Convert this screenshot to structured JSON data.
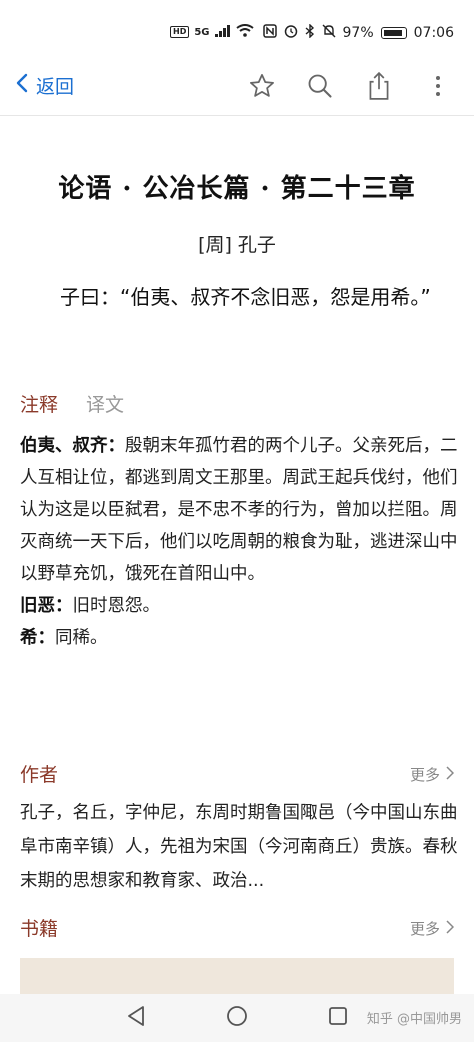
{
  "status_bar": {
    "hd": "HD",
    "network": "5G",
    "battery": "97%",
    "time": "07:06"
  },
  "nav": {
    "back_label": "返回",
    "icons": [
      "back-chevron-icon",
      "star-icon",
      "search-icon",
      "share-icon",
      "more-vertical-icon"
    ]
  },
  "article": {
    "title": "论语 · 公冶长篇 · 第二十三章",
    "author": "[周] 孔子",
    "text": "子曰：“伯夷、叔齐不念旧恶，怨是用希。”"
  },
  "tabs": [
    {
      "label": "注释",
      "active": true
    },
    {
      "label": "译文",
      "active": false
    }
  ],
  "notes": [
    {
      "term": "伯夷、叔齐",
      "sep": "：",
      "text": "殷朝末年孤竹君的两个儿子。父亲死后，二人互相让位，都逃到周文王那里。周武王起兵伐纣，他们认为这是以臣弑君，是不忠不孝的行为，曾加以拦阻。周灭商统一天下后，他们以吃周朝的粮食为耻，逃进深山中以野草充饥，饿死在首阳山中。"
    },
    {
      "term": "旧恶",
      "sep": "：",
      "text": "旧时恩怨。"
    },
    {
      "term": "希",
      "sep": "：",
      "text": "同稀。"
    }
  ],
  "author_section": {
    "title": "作者",
    "more": "更多",
    "bio": "孔子，名丘，字仲尼，东周时期鲁国陬邑（今中国山东曲阜市南辛镇）人，先祖为宋国（今河南商丘）贵族。春秋末期的思想家和教育家、政治..."
  },
  "books_section": {
    "title": "书籍",
    "more": "更多"
  },
  "watermark": "知乎 @中国帅男",
  "colors": {
    "accent": "#8b3a2a",
    "link": "#1b6fd1",
    "muted": "#999999"
  }
}
